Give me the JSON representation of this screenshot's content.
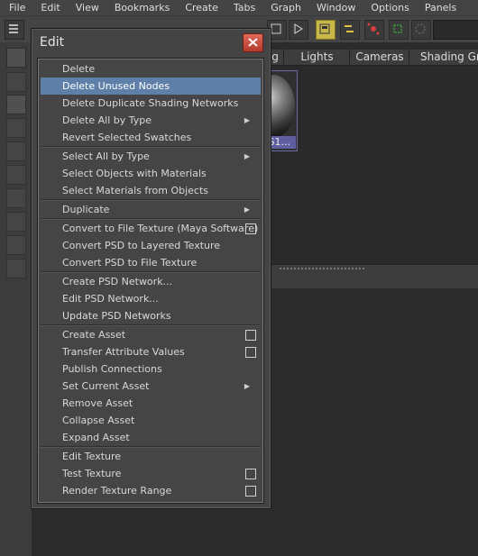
{
  "menubar": [
    "File",
    "Edit",
    "View",
    "Bookmarks",
    "Create",
    "Tabs",
    "Graph",
    "Window",
    "Options",
    "Panels"
  ],
  "tabs": [
    "g",
    "Lights",
    "Cameras",
    "Shading Grou"
  ],
  "swatch_label": "G1...",
  "edit_window": {
    "title": "Edit",
    "close_icon": "close-icon",
    "items": [
      {
        "label": "Delete"
      },
      {
        "label": "Delete Unused Nodes",
        "selected": true
      },
      {
        "label": "Delete Duplicate Shading Networks"
      },
      {
        "label": "Delete All by Type",
        "submenu": true
      },
      {
        "label": "Revert Selected Swatches"
      },
      {
        "label": "Select All by Type",
        "submenu": true
      },
      {
        "label": "Select Objects with Materials"
      },
      {
        "label": "Select Materials from Objects"
      },
      {
        "label": "Duplicate",
        "submenu": true
      },
      {
        "label": "Convert to File Texture (Maya Software)",
        "option": true
      },
      {
        "label": "Convert PSD to Layered Texture"
      },
      {
        "label": "Convert PSD to File Texture"
      },
      {
        "label": "Create PSD Network..."
      },
      {
        "label": "Edit PSD Network..."
      },
      {
        "label": "Update PSD Networks"
      },
      {
        "label": "Create Asset",
        "option": true
      },
      {
        "label": "Transfer Attribute Values",
        "option": true
      },
      {
        "label": "Publish Connections"
      },
      {
        "label": "Set Current Asset",
        "submenu": true
      },
      {
        "label": "Remove Asset"
      },
      {
        "label": "Collapse Asset"
      },
      {
        "label": "Expand Asset"
      },
      {
        "label": "Edit Texture"
      },
      {
        "label": "Test Texture",
        "option": true
      },
      {
        "label": "Render Texture Range",
        "option": true
      }
    ]
  },
  "colors": {
    "selection": "#5d7fa8",
    "close_button": "#c8483a",
    "highlight_tool": "#c8b84a"
  }
}
